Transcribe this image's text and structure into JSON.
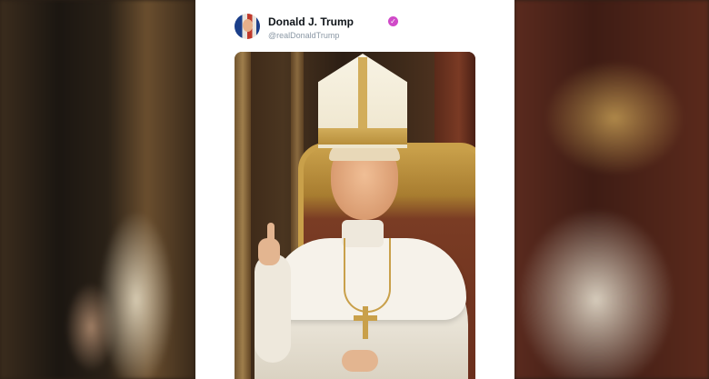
{
  "post": {
    "display_name": "Donald J. Trump",
    "handle": "@realDonaldTrump",
    "verified_icon": "verified-badge-icon",
    "badge_color": "#d04ac8"
  }
}
